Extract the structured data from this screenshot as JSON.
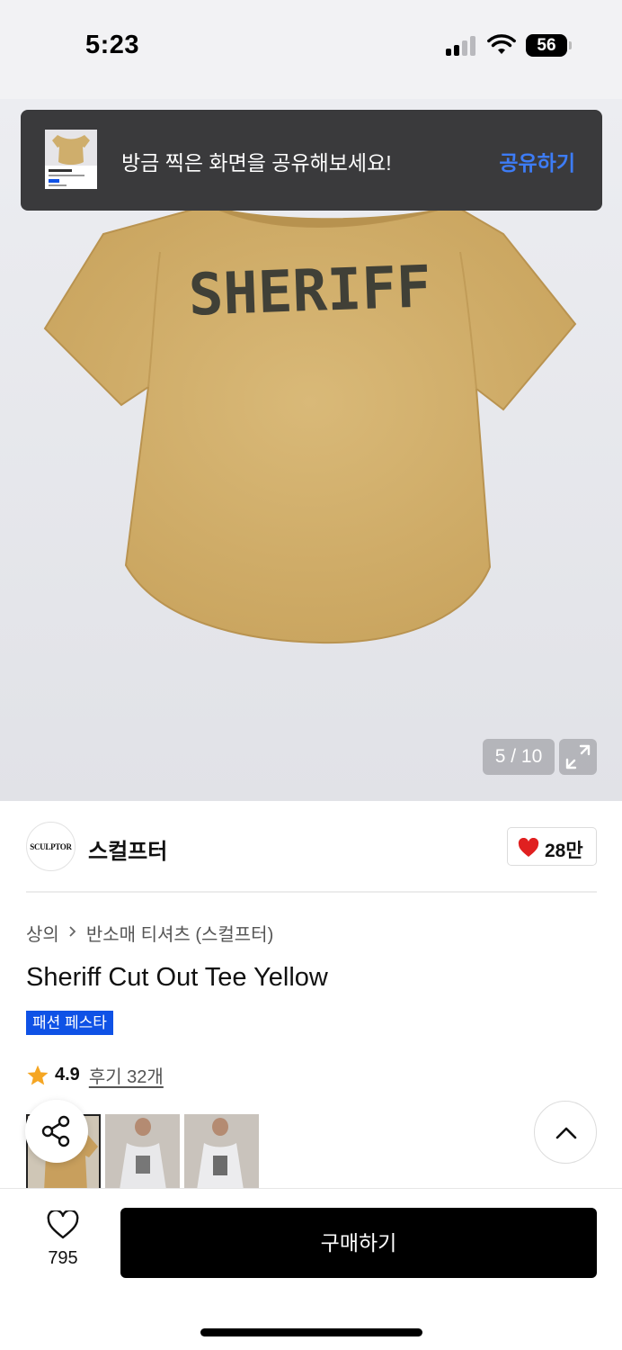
{
  "status_bar": {
    "time": "5:23",
    "battery": "56"
  },
  "toast": {
    "message": "방금 찍은 화면을 공유해보세요!",
    "action": "공유하기"
  },
  "hero": {
    "shirt_print": "SHERIFF",
    "pager": "5 / 10",
    "shirt_color": "#d4b26c"
  },
  "brand": {
    "logo_text": "SCULPTOR",
    "name": "스컬프터",
    "likes": "28만"
  },
  "product": {
    "breadcrumb": [
      "상의",
      "반소매 티셔츠 (스컬프터)"
    ],
    "title": "Sheriff Cut Out Tee Yellow",
    "badge": "패션 페스타",
    "rating": "4.9",
    "reviews": "후기 32개"
  },
  "bottom": {
    "wish_count": "795",
    "buy_label": "구매하기"
  },
  "colors": {
    "accent_blue": "#0f52e6",
    "toast_link": "#3d7cf6",
    "star": "#f5a623",
    "heart": "#e02020"
  }
}
